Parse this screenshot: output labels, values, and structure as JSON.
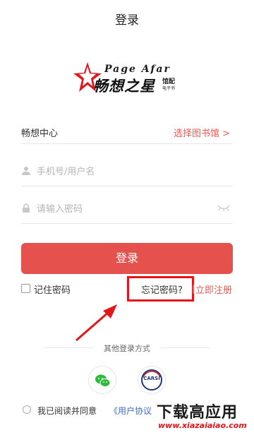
{
  "header": {
    "title": "登录"
  },
  "logo": {
    "en_text": "Page Afar",
    "cn_text": "畅想之星",
    "sub_1": "馆配",
    "sub_2": "电子书"
  },
  "center_row": {
    "label": "畅想中心",
    "select_library": "选择图书馆 >"
  },
  "username": {
    "placeholder": "手机号/用户名",
    "value": ""
  },
  "password": {
    "placeholder": "请输入密码",
    "value": ""
  },
  "login_button": "登录",
  "remember": {
    "label": "记住密码",
    "checked": false
  },
  "links": {
    "forgot": "忘记密码?",
    "separator": "|",
    "register": "立即注册"
  },
  "other_login": {
    "label": "其他登录方式",
    "carsi_label": "CARSI"
  },
  "agreement": {
    "text": "我已阅读并同意",
    "link": "《用户协议"
  },
  "watermark": {
    "cn": "下载高应用",
    "en": "www.xiazaiaiao.com"
  },
  "colors": {
    "accent": "#e5524d",
    "link_red": "#e85a50",
    "annotation_red": "#e2161b",
    "link_blue": "#3a6bd4"
  },
  "icons": [
    "user-icon",
    "lock-icon",
    "eye-closed-icon",
    "wechat-icon",
    "carsi-icon",
    "star-icon",
    "arrow-icon"
  ]
}
